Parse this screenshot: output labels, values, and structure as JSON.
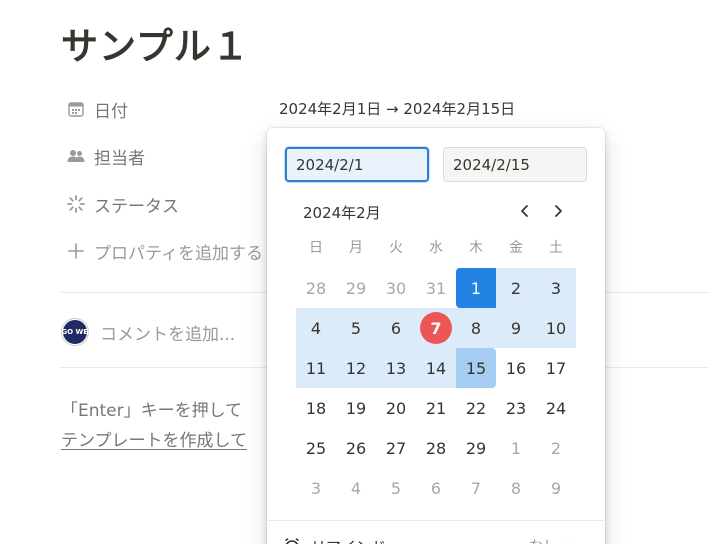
{
  "page": {
    "title": "サンプル１"
  },
  "properties": [
    {
      "icon": "calendar-icon",
      "label": "日付"
    },
    {
      "icon": "people-icon",
      "label": "担当者"
    },
    {
      "icon": "status-spinner-icon",
      "label": "ステータス"
    },
    {
      "icon": "plus-icon",
      "label": "プロパティを追加する"
    }
  ],
  "date_value": "2024年2月1日 → 2024年2月15日",
  "comment": {
    "avatar_text": "EGO WEB",
    "placeholder": "コメントを追加..."
  },
  "hint": {
    "line1": "「Enter」キーを押して",
    "link": "テンプレートを作成して"
  },
  "date_picker": {
    "start_input": "2024/2/1",
    "end_input": "2024/2/15",
    "month_label": "2024年2月",
    "weekdays": [
      "日",
      "月",
      "火",
      "水",
      "木",
      "金",
      "土"
    ],
    "weeks": [
      [
        "28",
        "29",
        "30",
        "31",
        "1",
        "2",
        "3"
      ],
      [
        "4",
        "5",
        "6",
        "7",
        "8",
        "9",
        "10"
      ],
      [
        "11",
        "12",
        "13",
        "14",
        "15",
        "16",
        "17"
      ],
      [
        "18",
        "19",
        "20",
        "21",
        "22",
        "23",
        "24"
      ],
      [
        "25",
        "26",
        "27",
        "28",
        "29",
        "1",
        "2"
      ],
      [
        "3",
        "4",
        "5",
        "6",
        "7",
        "8",
        "9"
      ]
    ],
    "selected_start": 1,
    "selected_end": 15,
    "today": 7,
    "reminder_label": "リマインド",
    "reminder_value": "なし",
    "colors": {
      "accent": "#2383e2",
      "range": "#dcebfa",
      "range_end": "#a6cdf2",
      "today": "#eb5757"
    }
  }
}
